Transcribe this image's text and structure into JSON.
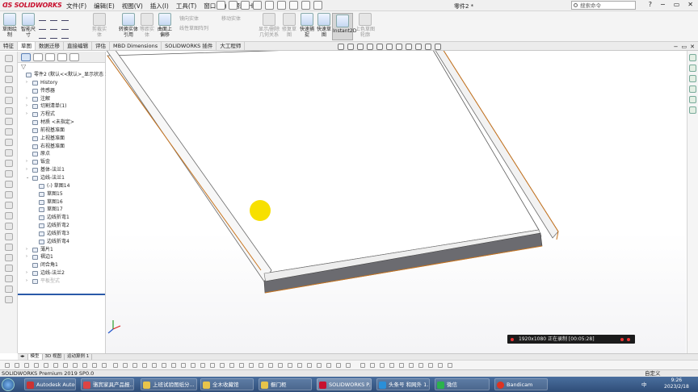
{
  "app": {
    "logo": "SOLIDWORKS",
    "menu": [
      "文件(F)",
      "编辑(E)",
      "视图(V)",
      "插入(I)",
      "工具(T)",
      "窗口(W)",
      "帮助(H)"
    ],
    "doc_title": "零件2 *",
    "search_placeholder": "搜索命令",
    "window_controls": [
      "?",
      "−",
      "▭",
      "✕"
    ]
  },
  "ribbon": {
    "sketch_label": "草图绘制",
    "smart_dim_label": "智能尺寸",
    "trim_label": "剪裁实体",
    "convert_label": "转换实体引用",
    "offset_label": "等距实体",
    "surface_offset_label": "曲面上偏移",
    "mirror_label": "镜向实体",
    "linear_pattern_label": "线性草图阵列",
    "move_label": "移动实体",
    "display_relations_label": "显示/删除几何关系",
    "repair_label": "修复草图",
    "quick_snap_label": "快速捕捉",
    "rapid_sketch_label": "快速草图",
    "instant2d_label": "Instant2D",
    "shaded_sketch_label": "上色草图轮廓"
  },
  "tabs": [
    "特征",
    "草图",
    "数据迁移",
    "直接编辑",
    "评估",
    "MBD Dimensions",
    "SOLIDWORKS 插件",
    "大工程师"
  ],
  "active_tab": "草图",
  "tree": [
    {
      "label": "零件2 (默认<<默认>_显示状态 1>)",
      "expand": "",
      "indent": 0
    },
    {
      "label": "History",
      "expand": "›",
      "indent": 1
    },
    {
      "label": "传感器",
      "expand": "",
      "indent": 1
    },
    {
      "label": "注解",
      "expand": "›",
      "indent": 1
    },
    {
      "label": "切割清单(1)",
      "expand": "›",
      "indent": 1
    },
    {
      "label": "方程式",
      "expand": "›",
      "indent": 1
    },
    {
      "label": "材质 <未指定>",
      "expand": "",
      "indent": 1
    },
    {
      "label": "前视基准面",
      "expand": "",
      "indent": 1
    },
    {
      "label": "上视基准面",
      "expand": "",
      "indent": 1
    },
    {
      "label": "右视基准面",
      "expand": "",
      "indent": 1
    },
    {
      "label": "原点",
      "expand": "",
      "indent": 1
    },
    {
      "label": "钣金",
      "expand": "›",
      "indent": 1
    },
    {
      "label": "基体-法兰1",
      "expand": "›",
      "indent": 1
    },
    {
      "label": "边线-法兰1",
      "expand": "⌄",
      "indent": 1
    },
    {
      "label": "(-) 草图14",
      "expand": "",
      "indent": 2
    },
    {
      "label": "草图15",
      "expand": "",
      "indent": 2
    },
    {
      "label": "草图16",
      "expand": "",
      "indent": 2
    },
    {
      "label": "草图17",
      "expand": "",
      "indent": 2
    },
    {
      "label": "边线折弯1",
      "expand": "",
      "indent": 2
    },
    {
      "label": "边线折弯2",
      "expand": "",
      "indent": 2
    },
    {
      "label": "边线折弯3",
      "expand": "",
      "indent": 2
    },
    {
      "label": "边线折弯4",
      "expand": "",
      "indent": 2
    },
    {
      "label": "薄片1",
      "expand": "›",
      "indent": 1
    },
    {
      "label": "褶边1",
      "expand": "›",
      "indent": 1
    },
    {
      "label": "闭合角1",
      "expand": "",
      "indent": 1
    },
    {
      "label": "边线-法兰2",
      "expand": "›",
      "indent": 1
    },
    {
      "label": "平板型式",
      "expand": "›",
      "indent": 1,
      "dim": true
    }
  ],
  "model_tabs": [
    "模型",
    "3D 视图",
    "运动算例 1"
  ],
  "status": {
    "left": "SOLIDWORKS Premium 2019 SP0.0",
    "right": "自定义"
  },
  "recorder": {
    "text": "1920x1080  正在录制 [00:05:28]"
  },
  "taskbar": {
    "items": [
      {
        "label": "Autodesk AutoC..."
      },
      {
        "label": "骆宾家具产品报..."
      },
      {
        "label": "上班试验图纸分..."
      },
      {
        "label": "全木收藏馆"
      },
      {
        "label": "橱门柜"
      },
      {
        "label": "SOLIDWORKS P..."
      },
      {
        "label": "头条号 和网外 1..."
      },
      {
        "label": "微信"
      },
      {
        "label": "Bandicam"
      }
    ],
    "tray": "中",
    "time": "9:26",
    "date": "2023/2/18"
  },
  "colors": {
    "plate_face": "#ffffff",
    "plate_side": "#6b6b6b",
    "plate_edge": "#c8741e",
    "cursor_highlight": "#f7e000",
    "taskbar": "#355582"
  }
}
